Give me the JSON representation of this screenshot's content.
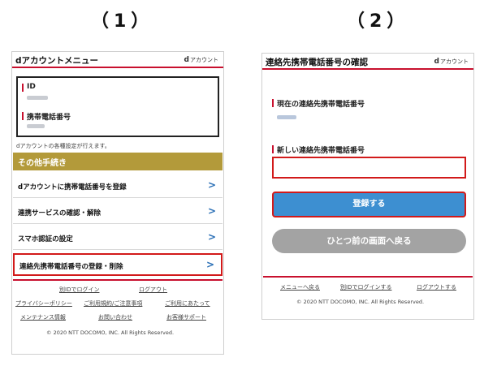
{
  "labels": {
    "step1": "（1）",
    "step2": "（2）"
  },
  "screen1": {
    "header_title": "dアカウントメニュー",
    "logo_mark": "d",
    "logo_text": "アカウント",
    "id_label": "ID",
    "phone_label": "携帯電話番号",
    "settings_note": "dアカウントの各種設定が行えます。",
    "section_title": "その他手続き",
    "menu_items": [
      {
        "label": "dアカウントに携帯電話番号を登録"
      },
      {
        "label": "連携サービスの確認・解除"
      },
      {
        "label": "スマホ認証の設定"
      },
      {
        "label": "連絡先携帯電話番号の登録・削除"
      }
    ],
    "footer_links": {
      "id_login": "別IDでログイン",
      "logout": "ログアウト",
      "privacy": "プライバシーポリシー",
      "terms": "ご利用規約/ご注意事項",
      "usage": "ご利用にあたって",
      "maintenance": "メンテナンス情報",
      "contact": "お問い合わせ",
      "support": "お客様サポート"
    },
    "copyright": "© 2020 NTT DOCOMO, INC. All Rights Reserved."
  },
  "screen2": {
    "header_title": "連絡先携帯電話番号の確認",
    "logo_mark": "d",
    "logo_text": "アカウント",
    "current_label": "現在の連絡先携帯電話番号",
    "new_label": "新しい連絡先携帯電話番号",
    "new_value": "",
    "register_button": "登録する",
    "back_button": "ひとつ前の画面へ戻る",
    "footer_links": {
      "menu_back": "メニューへ戻る",
      "id_login": "別IDでログインする",
      "logout": "ログアウトする"
    },
    "copyright": "© 2020 NTT DOCOMO, INC. All Rights Reserved."
  }
}
